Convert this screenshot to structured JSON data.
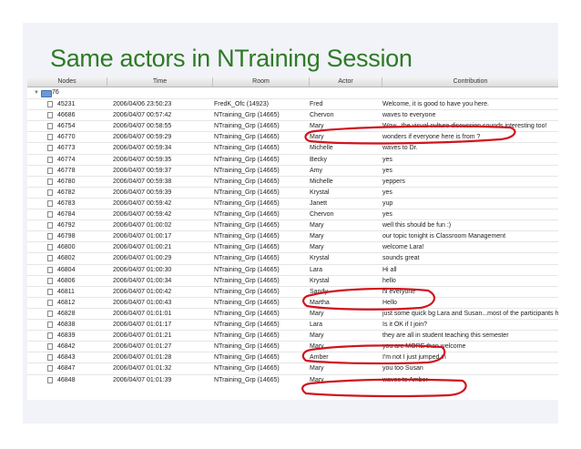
{
  "title": "Same actors in NTraining Session",
  "columns": [
    "Nodes",
    "Time",
    "Room",
    "Actor",
    "Contribution"
  ],
  "group": {
    "label": "76",
    "icon": "folder-icon",
    "expander_icon": "triangle-down-icon"
  },
  "colors": {
    "title": "#2f7a26",
    "annotation": "#d0141e",
    "slide_bg": "#f1f3f8"
  },
  "rows": [
    {
      "node": "45231",
      "time": "2006/04/06 23:50:23",
      "room": "FredK_Ofc (14923)",
      "actor": "Fred",
      "contribution": "Welcome, it is good to have you here."
    },
    {
      "node": "46686",
      "time": "2006/04/07 00:57:42",
      "room": "NTraining_Grp (14665)",
      "actor": "Chervon",
      "contribution": "waves to everyone"
    },
    {
      "node": "46754",
      "time": "2006/04/07 00:58:55",
      "room": "NTraining_Grp (14665)",
      "actor": "Mary",
      "contribution": "Wow...the visual culture discussion sounds interesting too!"
    },
    {
      "node": "46770",
      "time": "2006/04/07 00:59:29",
      "room": "NTraining_Grp (14665)",
      "actor": "Mary",
      "contribution": "wonders if everyone here is from ?"
    },
    {
      "node": "46773",
      "time": "2006/04/07 00:59:34",
      "room": "NTraining_Grp (14665)",
      "actor": "Michelle",
      "contribution": "waves to Dr."
    },
    {
      "node": "46774",
      "time": "2006/04/07 00:59:35",
      "room": "NTraining_Grp (14665)",
      "actor": "Becky",
      "contribution": "yes"
    },
    {
      "node": "46778",
      "time": "2006/04/07 00:59:37",
      "room": "NTraining_Grp (14665)",
      "actor": "Amy",
      "contribution": "yes"
    },
    {
      "node": "46780",
      "time": "2006/04/07 00:59:38",
      "room": "NTraining_Grp (14665)",
      "actor": "Michelle",
      "contribution": "yeppers"
    },
    {
      "node": "46782",
      "time": "2006/04/07 00:59:39",
      "room": "NTraining_Grp (14665)",
      "actor": "Krystal",
      "contribution": "yes"
    },
    {
      "node": "46783",
      "time": "2006/04/07 00:59:42",
      "room": "NTraining_Grp (14665)",
      "actor": "Janett",
      "contribution": "yup"
    },
    {
      "node": "46784",
      "time": "2006/04/07 00:59:42",
      "room": "NTraining_Grp (14665)",
      "actor": "Chervon",
      "contribution": "yes"
    },
    {
      "node": "46792",
      "time": "2006/04/07 01:00:02",
      "room": "NTraining_Grp (14665)",
      "actor": "Mary",
      "contribution": "well this should be fun :)"
    },
    {
      "node": "46798",
      "time": "2006/04/07 01:00:17",
      "room": "NTraining_Grp (14665)",
      "actor": "Mary",
      "contribution": "our topic tonight is Classroom Management"
    },
    {
      "node": "46800",
      "time": "2006/04/07 01:00:21",
      "room": "NTraining_Grp (14665)",
      "actor": "Mary",
      "contribution": "welcome Lara!"
    },
    {
      "node": "46802",
      "time": "2006/04/07 01:00:29",
      "room": "NTraining_Grp (14665)",
      "actor": "Krystal",
      "contribution": "sounds great"
    },
    {
      "node": "46804",
      "time": "2006/04/07 01:00:30",
      "room": "NTraining_Grp (14665)",
      "actor": "Lara",
      "contribution": "Hi all"
    },
    {
      "node": "46806",
      "time": "2006/04/07 01:00:34",
      "room": "NTraining_Grp (14665)",
      "actor": "Krystal",
      "contribution": "hello"
    },
    {
      "node": "46811",
      "time": "2006/04/07 01:00:42",
      "room": "NTraining_Grp (14665)",
      "actor": "Sandy",
      "contribution": "hi everyone"
    },
    {
      "node": "46812",
      "time": "2006/04/07 01:00:43",
      "room": "NTraining_Grp (14665)",
      "actor": "Martha",
      "contribution": "Hello"
    },
    {
      "node": "46828",
      "time": "2006/04/07 01:01:01",
      "room": "NTraining_Grp (14665)",
      "actor": "Mary",
      "contribution": "just some quick bg Lara and Susan...most of the participants her"
    },
    {
      "node": "46838",
      "time": "2006/04/07 01:01:17",
      "room": "NTraining_Grp (14665)",
      "actor": "Lara",
      "contribution": "Is it OK if I join?"
    },
    {
      "node": "46839",
      "time": "2006/04/07 01:01:21",
      "room": "NTraining_Grp (14665)",
      "actor": "Mary",
      "contribution": "they are all in student teaching this semester"
    },
    {
      "node": "46842",
      "time": "2006/04/07 01:01:27",
      "room": "NTraining_Grp (14665)",
      "actor": "Mary",
      "contribution": "you are MORE than welcome"
    },
    {
      "node": "46843",
      "time": "2006/04/07 01:01:28",
      "room": "NTraining_Grp (14665)",
      "actor": "Amber",
      "contribution": "I'm not I just jumped in"
    },
    {
      "node": "46847",
      "time": "2006/04/07 01:01:32",
      "room": "NTraining_Grp (14665)",
      "actor": "Mary",
      "contribution": "you too Susan"
    },
    {
      "node": "46848",
      "time": "2006/04/07 01:01:39",
      "room": "NTraining_Grp (14665)",
      "actor": "Mary",
      "contribution": "waves to Amber"
    }
  ]
}
